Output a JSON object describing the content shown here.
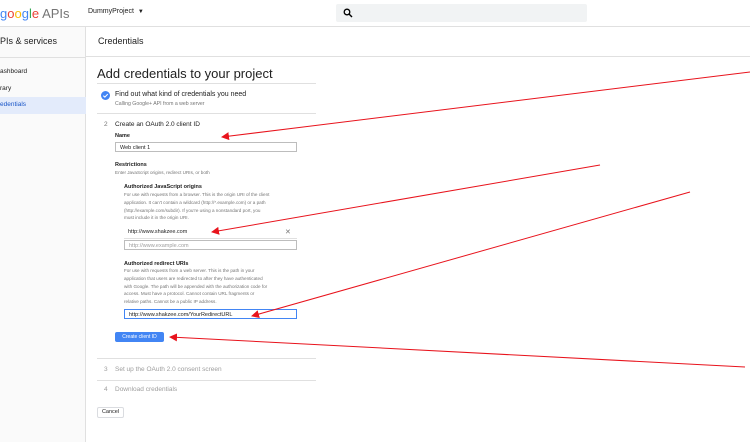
{
  "topbar": {
    "logo_parts": [
      "g",
      "o",
      "o",
      "g",
      "l",
      "e"
    ],
    "logo_suffix": "APIs",
    "project_name": "DummyProject",
    "search_placeholder": ""
  },
  "sidebar": {
    "title": "PIs & services",
    "items": [
      {
        "label": "ashboard",
        "active": false
      },
      {
        "label": "rary",
        "active": false
      },
      {
        "label": "edentials",
        "active": true
      }
    ]
  },
  "header": {
    "title": "Credentials"
  },
  "main": {
    "page_title": "Add credentials to your project",
    "step1": {
      "title": "Find out what kind of credentials you need",
      "subtitle": "Calling Google+ API from a web server"
    },
    "step2": {
      "number": "2",
      "title": "Create an OAuth 2.0 client ID",
      "name_label": "Name",
      "name_value": "Web client 1",
      "restrictions_label": "Restrictions",
      "restrictions_help": "Enter JavaScript origins, redirect URIs, or both",
      "js_origins_label": "Authorized JavaScript origins",
      "js_origins_help": [
        "For use with requests from a browser. This is the origin URI of the client",
        "application. It can't contain a wildcard (http://*.example.com) or a path",
        "(http://example.com/subdir). If you're using a nonstandard port, you",
        "must include it in the origin URI."
      ],
      "js_origin_value": "http://www.shakzee.com",
      "js_origin_placeholder": "http://www.example.com",
      "redirect_label": "Authorized redirect URIs",
      "redirect_help": [
        "For use with requests from a web server. This is the path in your",
        "application that users are redirected to after they have authenticated",
        "with Google. The path will be appended with the authorization code for",
        "access. Must have a protocol. Cannot contain URL fragments or",
        "relative paths. Cannot be a public IP address."
      ],
      "redirect_value": "http://www.shakzee.com/YourRedirectURL",
      "create_button": "Create client ID"
    },
    "step3": {
      "number": "3",
      "title": "Set up the OAuth 2.0 consent screen"
    },
    "step4": {
      "number": "4",
      "title": "Download credentials"
    },
    "cancel_button": "Cancel"
  },
  "colors": {
    "accent": "#4285f4",
    "annotation_arrow": "#e8131c",
    "active_nav_bg": "#e3ebfb"
  }
}
